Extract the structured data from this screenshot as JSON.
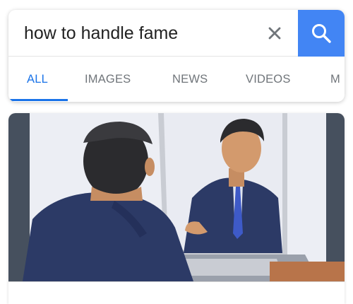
{
  "search": {
    "query": "how to handle fame",
    "clear_icon": "close-icon",
    "submit_icon": "search-icon",
    "accent_color": "#4285f4"
  },
  "tabs": [
    {
      "label": "ALL",
      "active": true
    },
    {
      "label": "IMAGES",
      "active": false
    },
    {
      "label": "NEWS",
      "active": false
    },
    {
      "label": "VIDEOS",
      "active": false
    },
    {
      "label": "M",
      "active": false
    }
  ],
  "result": {
    "image_subject": "illustration-man-looking-in-mirror"
  }
}
